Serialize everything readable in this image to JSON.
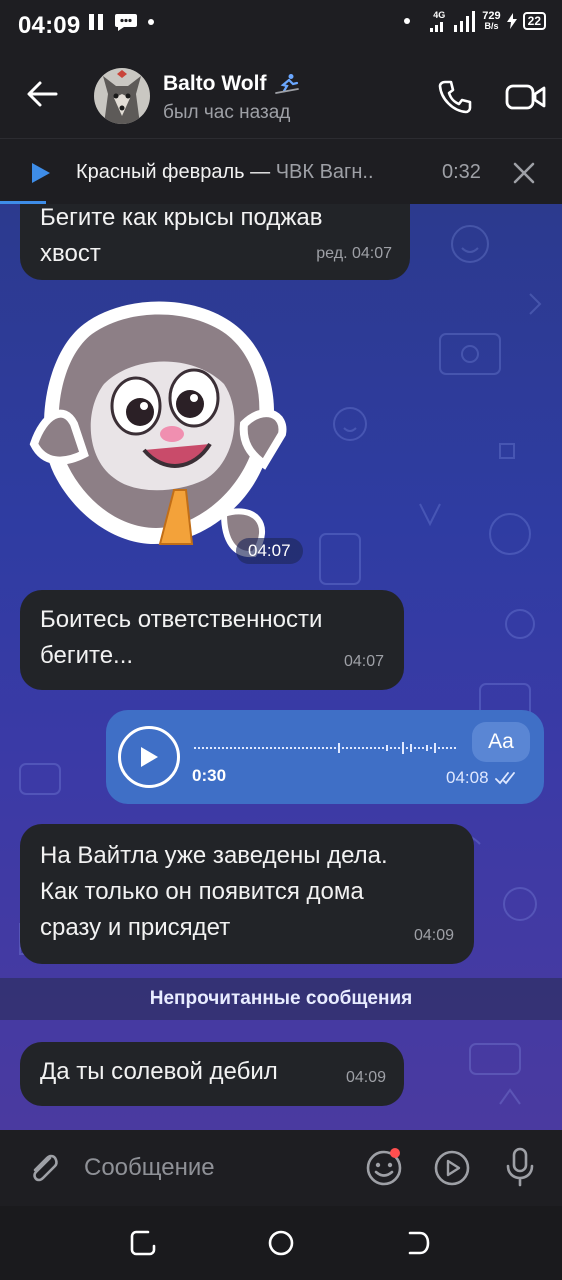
{
  "status_bar": {
    "time": "04:09",
    "network_type": "4G",
    "speed_value": "729",
    "speed_unit": "B/s",
    "battery": "22"
  },
  "header": {
    "contact_name": "Balto Wolf",
    "last_seen": "был час назад"
  },
  "player": {
    "track_title": "Красный февраль — ",
    "track_artist": "ЧВК Вагн..",
    "time": "0:32"
  },
  "messages": [
    {
      "type": "text",
      "direction": "in",
      "text_line1": "Бегите как крысы поджав",
      "text_line2": "хвост",
      "time": "ред. 04:07"
    },
    {
      "type": "sticker",
      "direction": "in",
      "time": "04:07"
    },
    {
      "type": "text",
      "direction": "in",
      "text_line1": "Боитесь ответственности",
      "text_line2": "бегите...",
      "time": "04:07"
    },
    {
      "type": "voice",
      "direction": "out",
      "duration": "0:30",
      "transcribe_label": "Aa",
      "time": "04:08"
    },
    {
      "type": "text",
      "direction": "in",
      "text_line1": "На Вайтла уже заведены дела.",
      "text_line2": "Как только он появится дома",
      "text_line3": "сразу и присядет",
      "time": "04:09"
    },
    {
      "type": "text",
      "direction": "in",
      "text_line1": "Да ты солевой дебил",
      "time": "04:09"
    }
  ],
  "unread_divider": "Непрочитанные сообщения",
  "composer": {
    "placeholder": "Сообщение"
  },
  "colors": {
    "incoming_bubble": "#222428",
    "outgoing_bubble": "#3f6fc6",
    "accent": "#3e8de8",
    "header_bg": "#1e1e22"
  }
}
